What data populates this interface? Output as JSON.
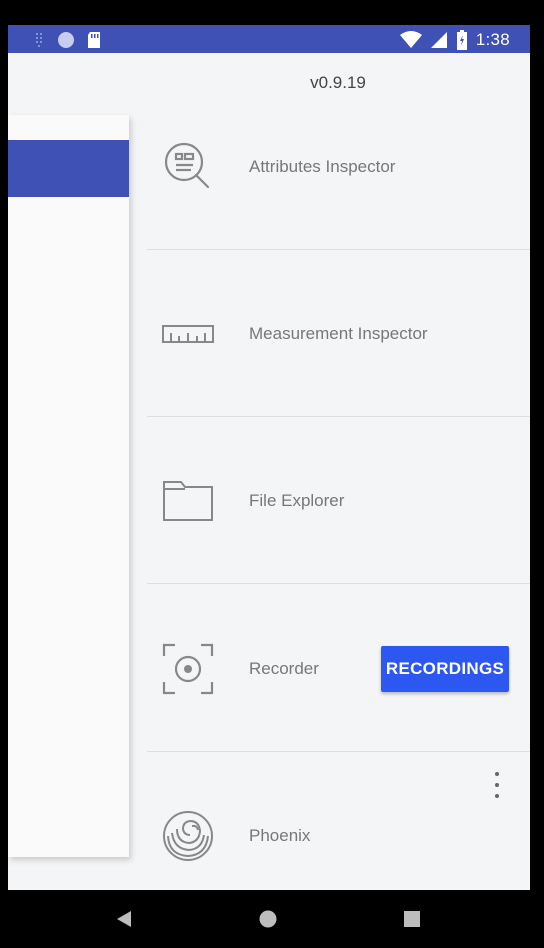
{
  "status_bar": {
    "time": "1:38",
    "icons": [
      "notification-dots-icon",
      "circle-icon",
      "sd-card-icon",
      "wifi-icon",
      "cell-signal-icon",
      "battery-icon"
    ]
  },
  "header": {
    "version": "v0.9.19"
  },
  "menu": {
    "items": [
      {
        "label": "Attributes Inspector",
        "icon": "attributes-inspector-icon"
      },
      {
        "label": "Measurement Inspector",
        "icon": "ruler-icon"
      },
      {
        "label": "File Explorer",
        "icon": "folder-icon"
      },
      {
        "label": "Recorder",
        "icon": "record-icon",
        "button_label": "RECORDINGS"
      },
      {
        "label": "Phoenix",
        "icon": "phoenix-icon"
      }
    ]
  },
  "colors": {
    "primary": "#3f51b5",
    "accent": "#2c57f0",
    "background": "#f4f5f7"
  },
  "nav_bar": {
    "buttons": [
      "back-icon",
      "home-icon",
      "recents-icon"
    ]
  }
}
